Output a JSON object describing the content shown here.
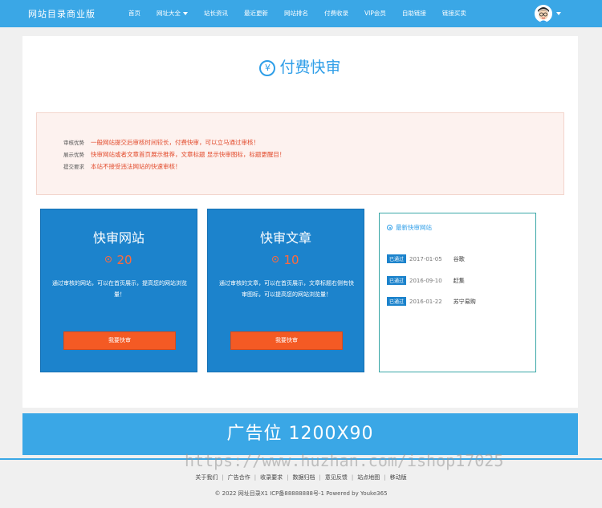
{
  "header": {
    "logo": "网站目录商业版",
    "nav": [
      "首页",
      "网址大全",
      "站长资讯",
      "最近更新",
      "网站排名",
      "付费收录",
      "VIP会员",
      "自助链接",
      "链接买卖"
    ]
  },
  "page": {
    "title": "付费快审",
    "title_icon": "¥"
  },
  "notice": {
    "rows": [
      {
        "label": "审核优势",
        "text": "一般网站提交后审核时间较长，付费快审，可以立马通过审核！"
      },
      {
        "label": "展示优势",
        "text": "快审网站或者文章首页展示推荐，文章标题 显示快审图标，标题更醒目！"
      },
      {
        "label": "提交要求",
        "text": "本站不接受违法网站的快速审核！"
      }
    ]
  },
  "cards": [
    {
      "title": "快审网站",
      "price": "20",
      "desc": "通过审核的网站，可以在首页展示，提高您的网站浏览量！",
      "button": "我要快审"
    },
    {
      "title": "快审文章",
      "price": "10",
      "desc": "通过审核的文章，可以在首页展示，文章标题右侧有快审图标，可以提高您的网站浏览量！",
      "button": "我要快审"
    }
  ],
  "latest": {
    "title": "最新快审网站",
    "items": [
      {
        "badge": "已通过",
        "date": "2017-01-05",
        "name": "谷歌"
      },
      {
        "badge": "已通过",
        "date": "2016-09-10",
        "name": "赶集"
      },
      {
        "badge": "已通过",
        "date": "2016-01-22",
        "name": "苏宁易购"
      }
    ]
  },
  "ad": {
    "text": "广告位  1200X90"
  },
  "watermark": "https://www.huzhan.com/ishop17025",
  "footer": {
    "links": [
      "关于我们",
      "广告合作",
      "收录要求",
      "数据归档",
      "意见反馈",
      "站点地图",
      "移动版"
    ],
    "copyright": "© 2022 网址目录X1 ICP备88888888号-1 Powered by Youke365"
  },
  "colors": {
    "primary": "#3aa7e6",
    "card": "#1c83cc",
    "button": "#f45a24",
    "notice_text": "#e24b2c"
  }
}
